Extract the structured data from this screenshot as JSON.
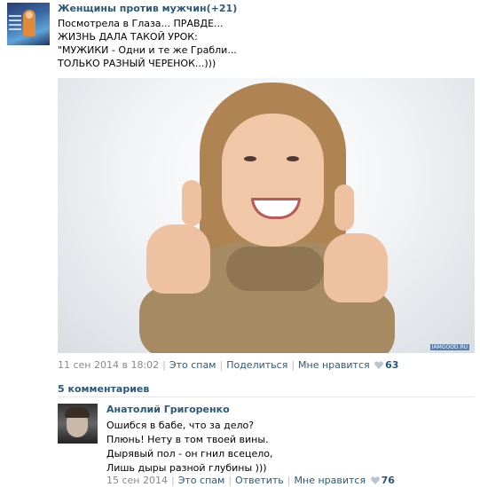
{
  "post": {
    "author": "Женщины против мужчин(+21)",
    "lines": [
      "Посмотрела в Глаза... ПРАВДЕ...",
      "ЖИЗНЬ ДАЛА ТАКОЙ УРОК:",
      "\"МУЖИКИ - Одни и те же Грабли...",
      "ТОЛЬКО РАЗНЫЙ ЧЕРЕНОК...)))"
    ],
    "watermark": "IAMGOOD.RU",
    "date": "11 сен 2014 в 18:02",
    "spam_label": "Это спам",
    "share_label": "Поделиться",
    "like_label": "Мне нравится",
    "like_count": "63"
  },
  "comments_header": "5 комментариев",
  "comment": {
    "author": "Анатолий Григоренко",
    "lines": [
      "Ошибся в бабе, что за дело?",
      "Плюнь! Нету в том твоей вины.",
      "Дырявый пол - он гнил всецело,",
      "Лишь дыры разной глубины )))"
    ],
    "date": "15 сен 2014",
    "spam_label": "Это спам",
    "reply_label": "Ответить",
    "like_label": "Мне нравится",
    "like_count": "76"
  },
  "colors": {
    "link": "#2b587a",
    "meta": "#888888",
    "heart": "#b9c5d3"
  }
}
